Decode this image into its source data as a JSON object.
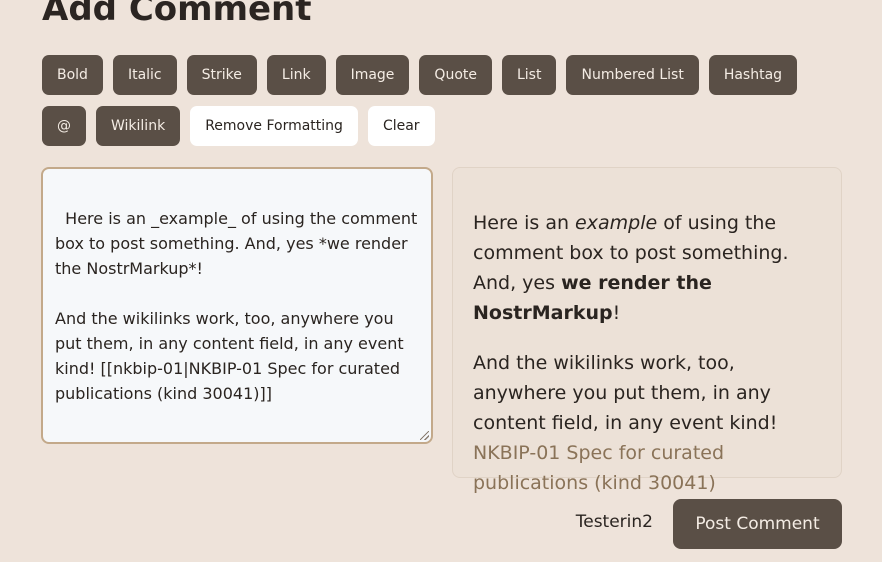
{
  "header": {
    "title": "Add Comment"
  },
  "toolbar": {
    "row1": [
      "Bold",
      "Italic",
      "Strike",
      "Link",
      "Image",
      "Quote",
      "List",
      "Numbered List",
      "Hashtag"
    ],
    "row2_dark": [
      "@",
      "Wikilink"
    ],
    "row2_light": [
      "Remove Formatting",
      "Clear"
    ]
  },
  "editor": {
    "value": "Here is an _example_ of using the comment box to post something. And, yes *we render the NostrMarkup*!\n\nAnd the wikilinks work, too, anywhere you put them, in any content field, in any event kind! [[nkbip-01|NKBIP-01 Spec for curated publications (kind 30041)]]"
  },
  "preview": {
    "p1_pre": "Here is an ",
    "p1_em": "example",
    "p1_mid": " of using the comment box to post something. And, yes ",
    "p1_strong": "we render the NostrMarkup",
    "p1_post": "!",
    "p2_pre": "And the wikilinks work, too, anywhere you put them, in any content field, in any event kind! ",
    "p2_link": "NKBIP-01 Spec for curated publications (kind 30041)"
  },
  "footer": {
    "username": "Testerin2",
    "post_label": "Post Comment"
  },
  "colors": {
    "background": "#eee3da",
    "button_dark": "#5a4f46",
    "button_light": "#ffffff",
    "link": "#8a7358",
    "editor_border": "#c3a98a"
  }
}
